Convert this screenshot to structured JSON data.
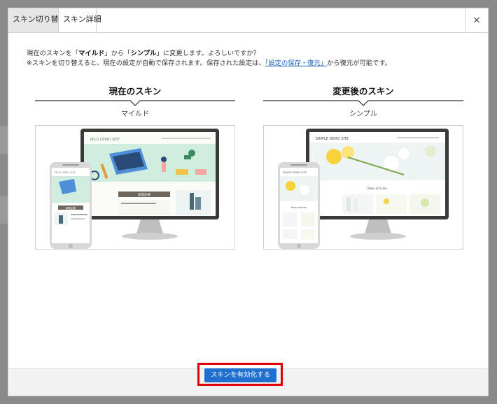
{
  "tabs": [
    {
      "label": "スキン切り替え",
      "active": true
    },
    {
      "label": "スキン詳細",
      "active": false
    }
  ],
  "close_label": "×",
  "message": {
    "line1_pre": "現在のスキンを「",
    "current_skin": "マイルド",
    "line1_mid": "」から「",
    "new_skin": "シンプル",
    "line1_post": "」に変更します。よろしいですか？",
    "line2_pre": "※スキンを切り替えると、現在の設定が自動で保存されます。保存された設定は、",
    "link_text": "「設定の保存・復元」",
    "line2_post": "から復元が可能です。"
  },
  "current": {
    "title": "現在のスキン",
    "name": "マイルド",
    "site_title": "MILD DEMO SITE",
    "banner": "新着記事"
  },
  "next": {
    "title": "変更後のスキン",
    "name": "シンプル",
    "site_title": "SIMPLE DEMO SITE",
    "section": "New articles"
  },
  "enable_button_label": "スキンを有効化する",
  "colors": {
    "accent": "#1f6fd1",
    "highlight": "#e00000",
    "link": "#1565c0"
  }
}
